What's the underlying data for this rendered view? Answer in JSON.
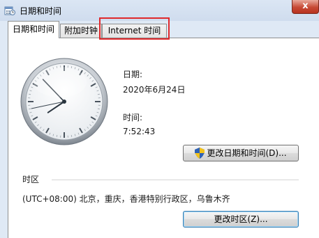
{
  "window": {
    "title": "日期和时间",
    "close_label": "x"
  },
  "tabs": [
    {
      "label": "日期和时间",
      "active": true
    },
    {
      "label": "附加时钟",
      "active": false
    },
    {
      "label": "Internet 时间",
      "active": false
    }
  ],
  "date_section": {
    "date_label": "日期:",
    "date_value": "2020年6月24日",
    "time_label": "时间:",
    "time_value": "7:52:43"
  },
  "clock": {
    "hour": 7,
    "minute": 52,
    "second": 43
  },
  "buttons": {
    "change_datetime": "更改日期和时间(D)...",
    "change_timezone": "更改时区(Z)..."
  },
  "timezone": {
    "heading": "时区",
    "value": "(UTC+08:00) 北京，重庆，香港特别行政区，乌鲁木齐"
  },
  "colors": {
    "highlight_box": "#e0282b",
    "close_button": "#c74a35"
  }
}
